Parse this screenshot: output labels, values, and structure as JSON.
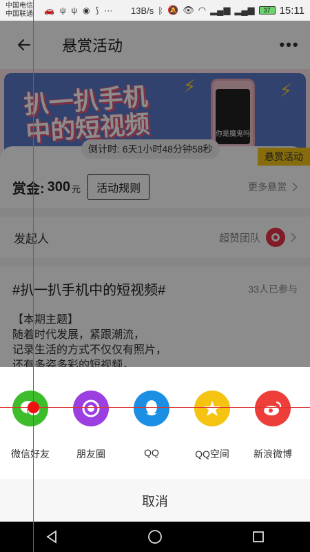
{
  "status_bar": {
    "carrier_1": "中国电信",
    "carrier_2": "中国联通",
    "net_speed": "13B/s",
    "battery": "37",
    "time": "15:11",
    "notif_more": "···"
  },
  "app_bar": {
    "title": "悬赏活动",
    "back_icon": "back-arrow-icon",
    "more_icon": "more-dots-icon",
    "more_glyph": "•••"
  },
  "banner": {
    "title_line1": "扒一扒手机",
    "title_line2": "中的短视频",
    "countdown": "倒计时: 6天1小时48分钟58秒",
    "badge": "悬赏活动",
    "phone_caption": "你是魔鬼吗"
  },
  "reward": {
    "label": "赏金:",
    "amount": "300",
    "unit": "元",
    "rules_button": "活动规则",
    "more_rewards": "更多悬赏"
  },
  "initiator": {
    "label": "发起人",
    "team": "超赞团队"
  },
  "topic": {
    "title": "#扒一扒手机中的短视频#",
    "participants": "33人已参与",
    "line1": "【本期主题】",
    "line2": "随着时代发展，紧跟潮流，",
    "line3": "记录生活的方式不仅仅有照片，",
    "line4": "还有多姿多彩的短视频，"
  },
  "share_sheet": {
    "items": [
      {
        "label": "微信好友",
        "icon": "wechat-icon",
        "color": "#3dbd2c"
      },
      {
        "label": "朋友圈",
        "icon": "moments-icon",
        "color": "#9b3fe0"
      },
      {
        "label": "QQ",
        "icon": "qq-icon",
        "color": "#1a8fe3"
      },
      {
        "label": "QQ空间",
        "icon": "qzone-icon",
        "color": "#f5c312"
      },
      {
        "label": "新浪微博",
        "icon": "weibo-icon",
        "color": "#ee3e3a"
      }
    ],
    "cancel": "取消"
  },
  "nav_bar": {
    "back": "back-triangle-icon",
    "home": "home-circle-icon",
    "recents": "recents-square-icon"
  }
}
